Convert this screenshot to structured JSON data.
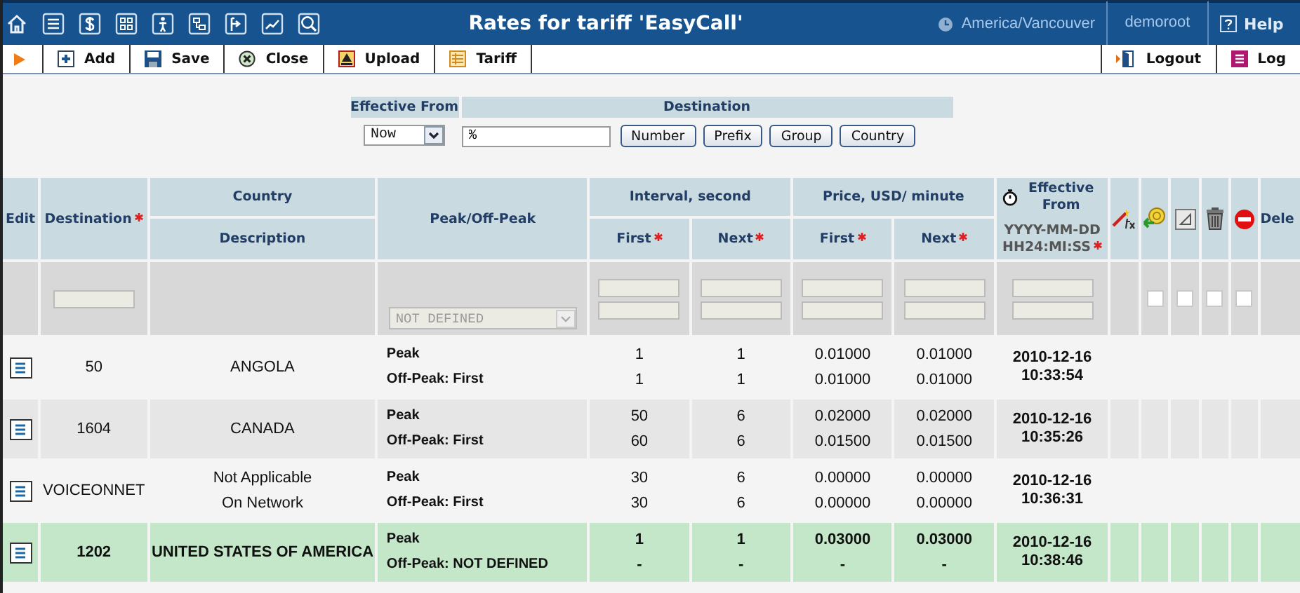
{
  "header": {
    "title": "Rates for tariff 'EasyCall'",
    "timezone": "America/Vancouver",
    "user": "demoroot",
    "help": "Help"
  },
  "toolbar": {
    "buttons": [
      {
        "kind": "add",
        "label": "Add"
      },
      {
        "kind": "save",
        "label": "Save"
      },
      {
        "kind": "close",
        "label": "Close"
      },
      {
        "kind": "upload",
        "label": "Upload"
      },
      {
        "kind": "tariff",
        "label": "Tariff"
      }
    ],
    "right_buttons": [
      {
        "kind": "logout",
        "label": "Logout"
      },
      {
        "kind": "log",
        "label": "Log"
      }
    ]
  },
  "filter": {
    "effective_from_label": "Effective From",
    "effective_from_value": "Now",
    "destination_label": "Destination",
    "destination_value": "%",
    "buttons": [
      "Number",
      "Prefix",
      "Group",
      "Country"
    ]
  },
  "columns": {
    "edit": "Edit",
    "destination": {
      "label": "Destination",
      "required": true
    },
    "country": "Country",
    "description": "Description",
    "peak": "Peak/Off-Peak",
    "interval": "Interval, second",
    "interval_first": {
      "label": "First",
      "required": true
    },
    "interval_next": {
      "label": "Next",
      "required": true
    },
    "price": "Price, USD/ minute",
    "price_first": {
      "label": "First",
      "required": true
    },
    "price_next": {
      "label": "Next",
      "required": true
    },
    "effective": "Effective From",
    "effective_format": {
      "label": "YYYY-MM-DD HH24:MI:SS",
      "required": true
    },
    "delete": "Dele"
  },
  "new_row": {
    "peak_select": "NOT DEFINED",
    "checkboxes": [
      {
        "checked": false
      },
      {
        "checked": false
      },
      {
        "checked": false
      },
      {
        "checked": false
      }
    ]
  },
  "rows": [
    {
      "destination": "50",
      "country": [
        "ANGOLA"
      ],
      "peak": [
        "Peak",
        "Off-Peak: First"
      ],
      "interval_first": [
        "1",
        "1"
      ],
      "interval_next": [
        "1",
        "1"
      ],
      "price_first": [
        "0.01000",
        "0.01000"
      ],
      "price_next": [
        "0.01000",
        "0.01000"
      ],
      "date": "2010-12-16",
      "time": "10:33:54",
      "highlighted": false
    },
    {
      "destination": "1604",
      "country": [
        "CANADA"
      ],
      "peak": [
        "Peak",
        "Off-Peak: First"
      ],
      "interval_first": [
        "50",
        "60"
      ],
      "interval_next": [
        "6",
        "6"
      ],
      "price_first": [
        "0.02000",
        "0.01500"
      ],
      "price_next": [
        "0.02000",
        "0.01500"
      ],
      "date": "2010-12-16",
      "time": "10:35:26",
      "highlighted": false
    },
    {
      "destination": "VOICEONNET",
      "country": [
        "Not Applicable",
        "On Network"
      ],
      "peak": [
        "Peak",
        "Off-Peak: First"
      ],
      "interval_first": [
        "30",
        "30"
      ],
      "interval_next": [
        "6",
        "6"
      ],
      "price_first": [
        "0.00000",
        "0.00000"
      ],
      "price_next": [
        "0.00000",
        "0.00000"
      ],
      "date": "2010-12-16",
      "time": "10:36:31",
      "highlighted": false
    },
    {
      "destination": "1202",
      "country": [
        "UNITED STATES OF AMERICA"
      ],
      "peak": [
        "Peak",
        "Off-Peak: NOT DEFINED"
      ],
      "interval_first": [
        "1",
        "-"
      ],
      "interval_next": [
        "1",
        "-"
      ],
      "price_first": [
        "0.03000",
        "-"
      ],
      "price_next": [
        "0.03000",
        "-"
      ],
      "date": "2010-12-16",
      "time": "10:38:46",
      "highlighted": true
    }
  ]
}
